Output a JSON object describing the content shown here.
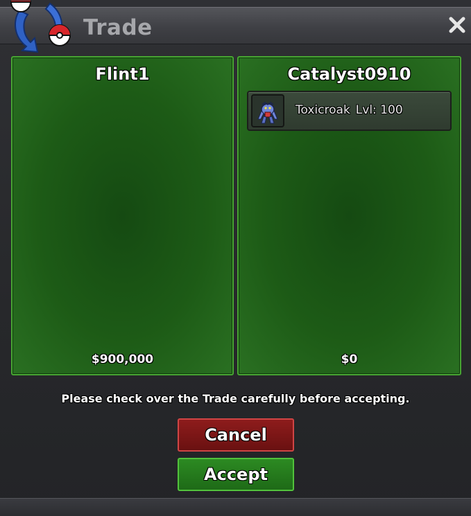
{
  "window": {
    "title": "Trade"
  },
  "icons": {
    "logo": "trade-pokeball-logo-icon",
    "close": "close-icon",
    "item": "toxicroak-sprite-icon"
  },
  "colors": {
    "panel_green": "#1d5b16",
    "panel_border": "#47a532",
    "cancel_red": "#8e1c1c",
    "accept_green": "#2c8a22"
  },
  "trade": {
    "left": {
      "name": "Flint1",
      "money": "$900,000",
      "items": []
    },
    "right": {
      "name": "Catalyst0910",
      "money": "$0",
      "items": [
        {
          "name": "Toxicroak",
          "level": "Lvl: 100"
        }
      ]
    }
  },
  "notice": "Please check over the Trade carefully before accepting.",
  "buttons": {
    "cancel": "Cancel",
    "accept": "Accept"
  }
}
